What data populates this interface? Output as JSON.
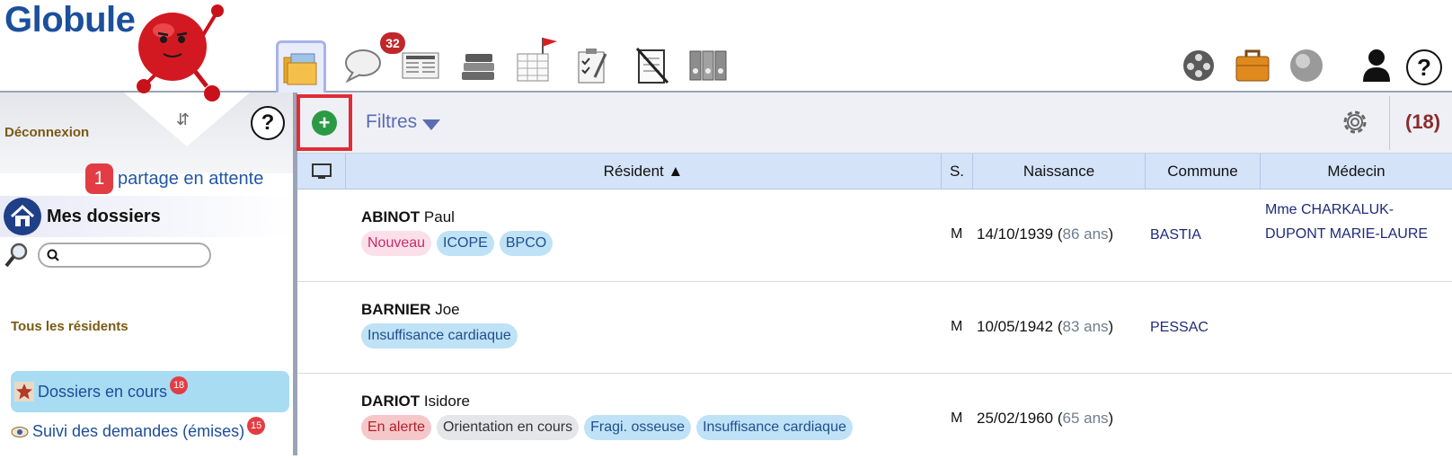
{
  "app": {
    "logo": "Globule"
  },
  "header": {
    "message_badge": "32",
    "tools": [
      {
        "icon": "folder-icon",
        "active": true
      },
      {
        "icon": "chat-bubble-icon"
      },
      {
        "icon": "newspaper-icon"
      },
      {
        "icon": "books-icon"
      },
      {
        "icon": "calendar-icon"
      },
      {
        "icon": "clipboard-icon"
      },
      {
        "icon": "notepad-icon"
      },
      {
        "icon": "binders-icon"
      }
    ],
    "right_tools": [
      "film-reel-icon",
      "briefcase-icon",
      "grey-ball-icon",
      "user-icon",
      "help-icon"
    ],
    "help_symbol": "?"
  },
  "sidebar": {
    "deconnexion": "Déconnexion",
    "help_symbol": "?",
    "share_count": "1",
    "share_label": "partage en attente",
    "mes_dossiers": "Mes dossiers",
    "search_placeholder": "",
    "tous_residents": "Tous les résidents",
    "dossiers_en_cours": "Dossiers en cours",
    "dossiers_en_cours_count": "18",
    "suivi_demandes": "Suivi des demandes (émises)",
    "suivi_demandes_count": "15"
  },
  "toolbar": {
    "add_symbol": "+",
    "filtres": "Filtres",
    "total": "(18)"
  },
  "table": {
    "columns": [
      "Résident ▲",
      "S.",
      "Naissance",
      "Commune",
      "Médecin"
    ],
    "rows": [
      {
        "last": "ABINOT",
        "first": "Paul",
        "tags": [
          {
            "label": "Nouveau",
            "color": "pink"
          },
          {
            "label": "ICOPE",
            "color": "blue"
          },
          {
            "label": "BPCO",
            "color": "blue"
          }
        ],
        "sex": "M",
        "dob": "14/10/1939",
        "age": "86 ans",
        "commune": "BASTIA",
        "medecin": "Mme CHARKALUK-DUPONT MARIE-LAURE"
      },
      {
        "last": "BARNIER",
        "first": "Joe",
        "tags": [
          {
            "label": "Insuffisance cardiaque",
            "color": "blue"
          }
        ],
        "sex": "M",
        "dob": "10/05/1942",
        "age": "83 ans",
        "commune": "PESSAC",
        "medecin": ""
      },
      {
        "last": "DARIOT",
        "first": "Isidore",
        "tags": [
          {
            "label": "En alerte",
            "color": "red"
          },
          {
            "label": "Orientation en cours",
            "color": "grey"
          },
          {
            "label": "Fragi. osseuse",
            "color": "blue"
          },
          {
            "label": "Insuffisance cardiaque",
            "color": "blue"
          }
        ],
        "sex": "M",
        "dob": "25/02/1960",
        "age": "65 ans",
        "commune": "",
        "medecin": ""
      }
    ]
  }
}
